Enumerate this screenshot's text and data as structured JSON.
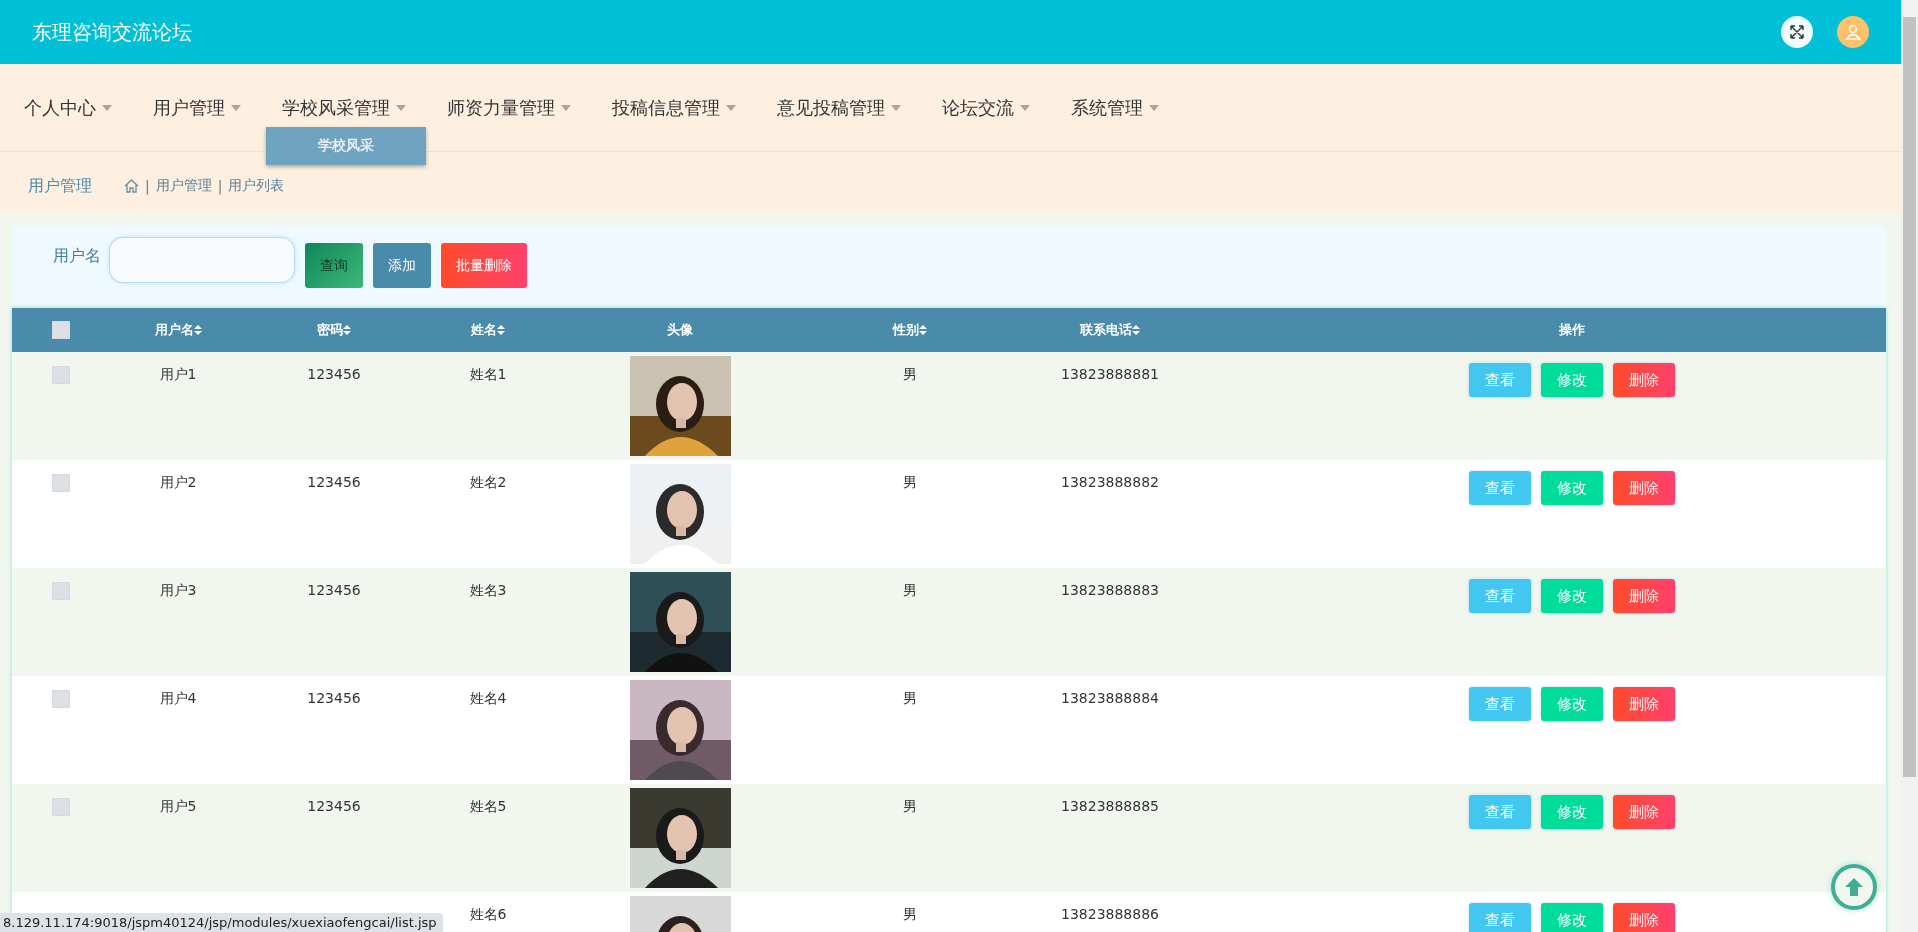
{
  "header": {
    "title": "东理咨询交流论坛"
  },
  "nav": [
    {
      "label": "个人中心",
      "expanded": false
    },
    {
      "label": "用户管理",
      "expanded": false
    },
    {
      "label": "学校风采管理",
      "expanded": true,
      "children": [
        "学校风采"
      ]
    },
    {
      "label": "师资力量管理",
      "expanded": false
    },
    {
      "label": "投稿信息管理",
      "expanded": false
    },
    {
      "label": "意见投稿管理",
      "expanded": false
    },
    {
      "label": "论坛交流",
      "expanded": false
    },
    {
      "label": "系统管理",
      "expanded": false
    }
  ],
  "breadcrumb": {
    "title": "用户管理",
    "separator": "|",
    "items": [
      "用户管理",
      "用户列表"
    ]
  },
  "search": {
    "label": "用户名",
    "buttons": [
      {
        "label": "查询",
        "kind": "query"
      },
      {
        "label": "添加",
        "kind": "add"
      },
      {
        "label": "批量删除",
        "kind": "delete"
      }
    ]
  },
  "table": {
    "select_all": {
      "checked": false
    },
    "columns": [
      {
        "label": "用户名",
        "sortable": true
      },
      {
        "label": "密码",
        "sortable": true
      },
      {
        "label": "姓名",
        "sortable": true
      },
      {
        "label": "头像",
        "sortable": false
      },
      {
        "label": "性别",
        "sortable": true
      },
      {
        "label": "联系电话",
        "sortable": true
      },
      {
        "label": "操作",
        "sortable": false
      }
    ],
    "rows": [
      {
        "checked": false,
        "username": "用户1",
        "password": "123456",
        "name": "姓名1",
        "gender": "男",
        "phone": "13823888881",
        "actions": [
          "查看",
          "修改",
          "删除"
        ]
      },
      {
        "checked": false,
        "username": "用户2",
        "password": "123456",
        "name": "姓名2",
        "gender": "男",
        "phone": "13823888882",
        "actions": [
          "查看",
          "修改",
          "删除"
        ]
      },
      {
        "checked": false,
        "username": "用户3",
        "password": "123456",
        "name": "姓名3",
        "gender": "男",
        "phone": "13823888883",
        "actions": [
          "查看",
          "修改",
          "删除"
        ]
      },
      {
        "checked": false,
        "username": "用户4",
        "password": "123456",
        "name": "姓名4",
        "gender": "男",
        "phone": "13823888884",
        "actions": [
          "查看",
          "修改",
          "删除"
        ]
      },
      {
        "checked": false,
        "username": "用户5",
        "password": "123456",
        "name": "姓名5",
        "gender": "男",
        "phone": "13823888885",
        "actions": [
          "查看",
          "修改",
          "删除"
        ]
      },
      {
        "name": "姓名6",
        "gender": "男",
        "phone": "13823888886",
        "actions": [
          "查看",
          "修改",
          "删除"
        ]
      }
    ]
  },
  "status_bar": {
    "url": "8.129.11.174:9018/jspm40124/jsp/modules/xuexiaofengcai/list.jsp"
  }
}
